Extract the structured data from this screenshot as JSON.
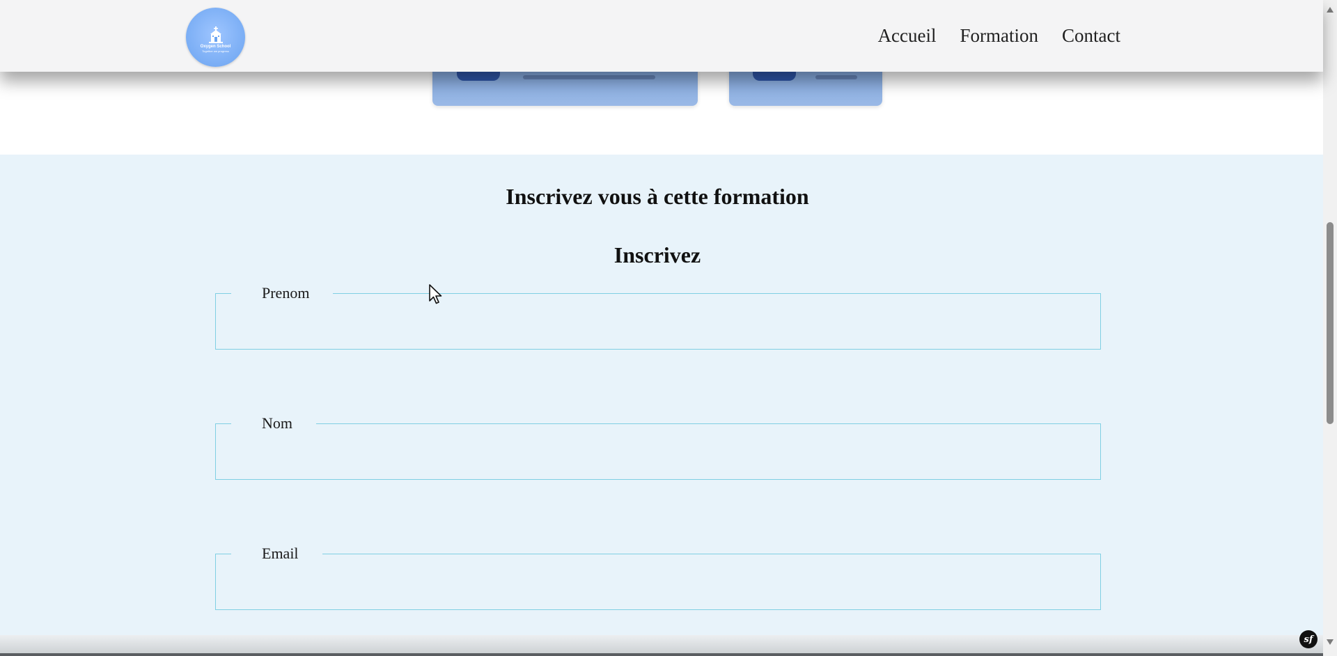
{
  "header": {
    "logo": {
      "name": "Oxygen School",
      "tagline": "Together we progress",
      "icon": "school-building-icon"
    },
    "nav": [
      {
        "label": "Accueil"
      },
      {
        "label": "Formation"
      },
      {
        "label": "Contact"
      }
    ]
  },
  "form": {
    "title": "Inscrivez vous à cette formation",
    "subtitle": "Inscrivez",
    "fields": [
      {
        "label": "Prenom",
        "value": ""
      },
      {
        "label": "Nom",
        "value": ""
      },
      {
        "label": "Email",
        "value": ""
      }
    ]
  },
  "colors": {
    "header_bg": "#f4f4f5",
    "section_bg": "#e8f3fa",
    "field_border": "#7fcfe3",
    "logo_bg": "#7fb2f5",
    "card_bg": "#8fb1e3",
    "card_accent": "#2f56a8"
  },
  "badges": {
    "symfony": "sf"
  },
  "icons": {
    "scroll_up": "arrow-up-icon",
    "scroll_down": "arrow-down-icon",
    "cursor": "mouse-pointer-icon"
  }
}
